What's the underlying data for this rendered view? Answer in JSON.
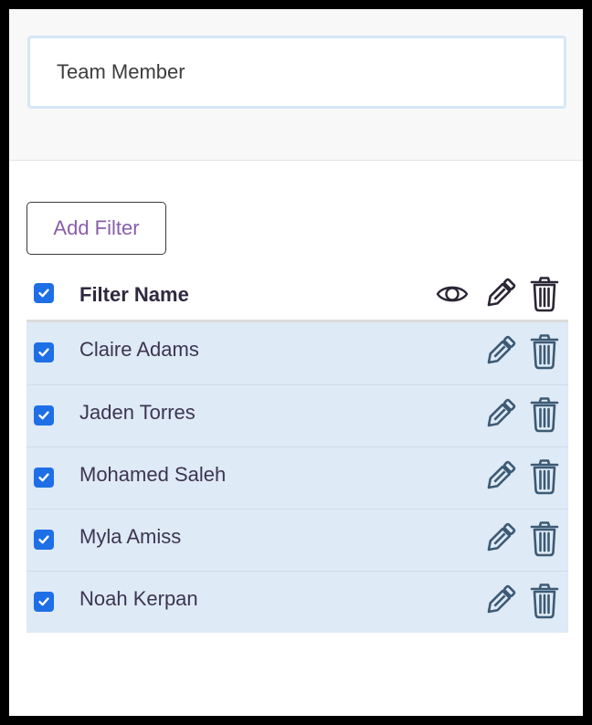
{
  "team_member_input": {
    "value": "Team Member"
  },
  "add_filter_button": {
    "label": "Add Filter"
  },
  "table": {
    "header": {
      "label": "Filter Name",
      "checked": true
    },
    "rows": [
      {
        "label": "Claire Adams",
        "checked": true
      },
      {
        "label": "Jaden Torres",
        "checked": true
      },
      {
        "label": "Mohamed Saleh",
        "checked": true
      },
      {
        "label": "Myla Amiss",
        "checked": true
      },
      {
        "label": "Noah Kerpan",
        "checked": true
      }
    ]
  },
  "icons": {
    "header": [
      "eye-icon",
      "pencil-icon",
      "trash-icon"
    ],
    "row": [
      "pencil-icon",
      "trash-icon"
    ]
  },
  "colors": {
    "checkbox": "#1e6fe6",
    "row_background": "#deeaf6",
    "input_border": "#d6e6f7",
    "button_text": "#8a5ea8",
    "header_icon": "#2b2535",
    "row_icon": "#3d5a74"
  }
}
